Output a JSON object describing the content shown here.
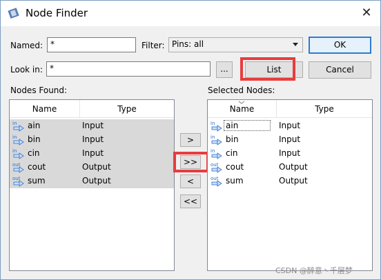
{
  "window": {
    "title": "Node Finder",
    "close_glyph": "✕"
  },
  "form": {
    "named_label": "Named:",
    "named_value": "*",
    "filter_label": "Filter:",
    "filter_value": "Pins: all",
    "lookin_label": "Look in:",
    "lookin_value": "*",
    "browse_label": "..."
  },
  "buttons": {
    "ok": "OK",
    "list": "List",
    "cancel": "Cancel"
  },
  "nodes_found": {
    "label": "Nodes Found:",
    "col_name": "Name",
    "col_type": "Type",
    "rows": [
      {
        "tag": "in",
        "name": "ain",
        "type": "Input"
      },
      {
        "tag": "in",
        "name": "bin",
        "type": "Input"
      },
      {
        "tag": "in",
        "name": "cin",
        "type": "Input"
      },
      {
        "tag": "out",
        "name": "cout",
        "type": "Output"
      },
      {
        "tag": "out",
        "name": "sum",
        "type": "Output"
      }
    ]
  },
  "selected_nodes": {
    "label": "Selected Nodes:",
    "col_name": "Name",
    "col_type": "Type",
    "rows": [
      {
        "tag": "in",
        "name": "ain",
        "type": "Input"
      },
      {
        "tag": "in",
        "name": "bin",
        "type": "Input"
      },
      {
        "tag": "in",
        "name": "cin",
        "type": "Input"
      },
      {
        "tag": "out",
        "name": "cout",
        "type": "Output"
      },
      {
        "tag": "out",
        "name": "sum",
        "type": "Output"
      }
    ]
  },
  "move": {
    "add_one": ">",
    "add_all": ">>",
    "remove_one": "<",
    "remove_all": "<<"
  },
  "watermark": "CSDN @醉意丶千层梦",
  "colors": {
    "highlight": "#e83c3c",
    "accent": "#2e7bd1",
    "pin_blue": "#2a6fd0"
  },
  "icons": {
    "app": "node-finder-app-icon",
    "pin_in": "input-pin-icon",
    "pin_out": "output-pin-icon"
  }
}
